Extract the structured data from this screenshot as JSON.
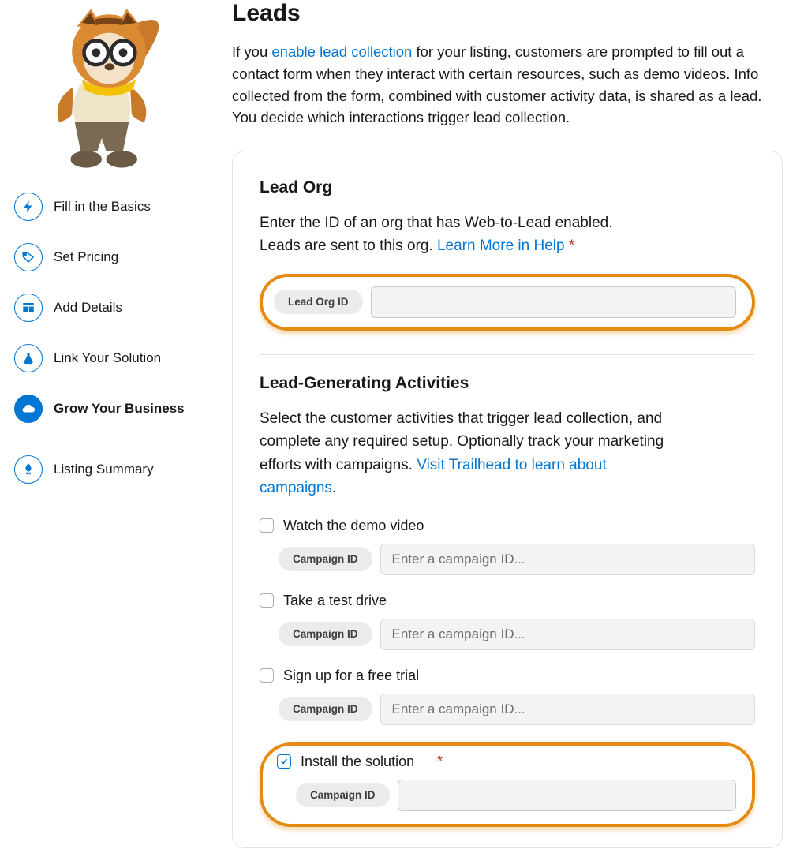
{
  "sidebar": {
    "items": [
      {
        "label": "Fill in the Basics"
      },
      {
        "label": "Set Pricing"
      },
      {
        "label": "Add Details"
      },
      {
        "label": "Link Your Solution"
      },
      {
        "label": "Grow Your Business"
      },
      {
        "label": "Listing Summary"
      }
    ]
  },
  "page": {
    "title": "Leads",
    "intro_pre": "If you ",
    "intro_link": "enable lead collection",
    "intro_post": " for your listing, customers are prompted to fill out a contact form when they interact with certain resources, such as demo videos. Info collected from the form, combined with customer activity data, is shared as a lead. You decide which interactions trigger lead collection."
  },
  "lead_org": {
    "title": "Lead Org",
    "line1": "Enter the ID of an org that has Web-to-Lead enabled.",
    "line2_pre": "Leads are sent to this org. ",
    "line2_link": "Learn More in Help",
    "pill": "Lead Org ID"
  },
  "activities": {
    "title": "Lead-Generating Activities",
    "body_pre": "Select the customer activities that trigger lead collection, and complete any required setup. Optionally track your marketing efforts with campaigns. ",
    "body_link": "Visit Trailhead to learn about campaigns",
    "pill": "Campaign ID",
    "placeholder": "Enter a campaign ID...",
    "items": [
      {
        "label": "Watch the demo video",
        "checked": false,
        "required": false
      },
      {
        "label": "Take a test drive",
        "checked": false,
        "required": false
      },
      {
        "label": "Sign up for a free trial",
        "checked": false,
        "required": false
      },
      {
        "label": "Install the solution",
        "checked": true,
        "required": true
      }
    ]
  }
}
